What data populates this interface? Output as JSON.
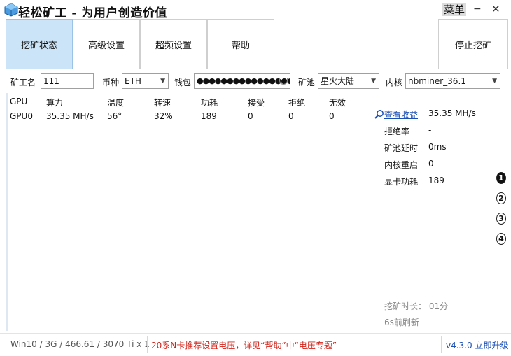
{
  "window": {
    "title": "轻松矿工 - 为用户创造价值",
    "menu_label": "菜单",
    "minimize_glyph": "−",
    "close_glyph": "✕"
  },
  "tabs": [
    {
      "label": "挖矿状态",
      "active": true
    },
    {
      "label": "高级设置",
      "active": false
    },
    {
      "label": "超频设置",
      "active": false
    },
    {
      "label": "帮助",
      "active": false
    }
  ],
  "stop_button": "停止挖矿",
  "config": {
    "worker_label": "矿工名",
    "worker_value": "111",
    "coin_label": "币种",
    "coin_value": "ETH",
    "wallet_label": "钱包",
    "wallet_value": "●●●●●●●●●●●●●●●●●●●●",
    "pool_label": "矿池",
    "pool_value": "星火大陆",
    "kernel_label": "内核",
    "kernel_value": "nbminer_36.1"
  },
  "gpu_table": {
    "headers": [
      "GPU",
      "算力",
      "温度",
      "转速",
      "功耗",
      "接受",
      "拒绝",
      "无效"
    ],
    "rows": [
      [
        "GPU0",
        "35.35 MH/s",
        "56°",
        "32%",
        "189",
        "0",
        "0",
        "0"
      ]
    ]
  },
  "stats": {
    "earnings_link": "查看收益",
    "hashrate": "35.35 MH/s",
    "reject_rate_label": "拒绝率",
    "reject_rate": "-",
    "latency_label": "矿池延时",
    "latency": "0ms",
    "restart_label": "内核重启",
    "restart": "0",
    "power_label": "显卡功耗",
    "power": "189"
  },
  "pages": [
    "1",
    "2",
    "3",
    "4"
  ],
  "runtime": "挖矿时长： 01分",
  "refresh": "6s前刷新",
  "statusbar": {
    "system": "Win10 / 3G / 466.61 / 3070 Ti x 1",
    "notice": "20系N卡推荐设置电压，详见“帮助”中“电压专题”",
    "version": "v4.3.0 立即升级"
  },
  "colors": {
    "active_tab": "#cce4f7",
    "link": "#1a4fb5",
    "notice": "#d0241a"
  }
}
